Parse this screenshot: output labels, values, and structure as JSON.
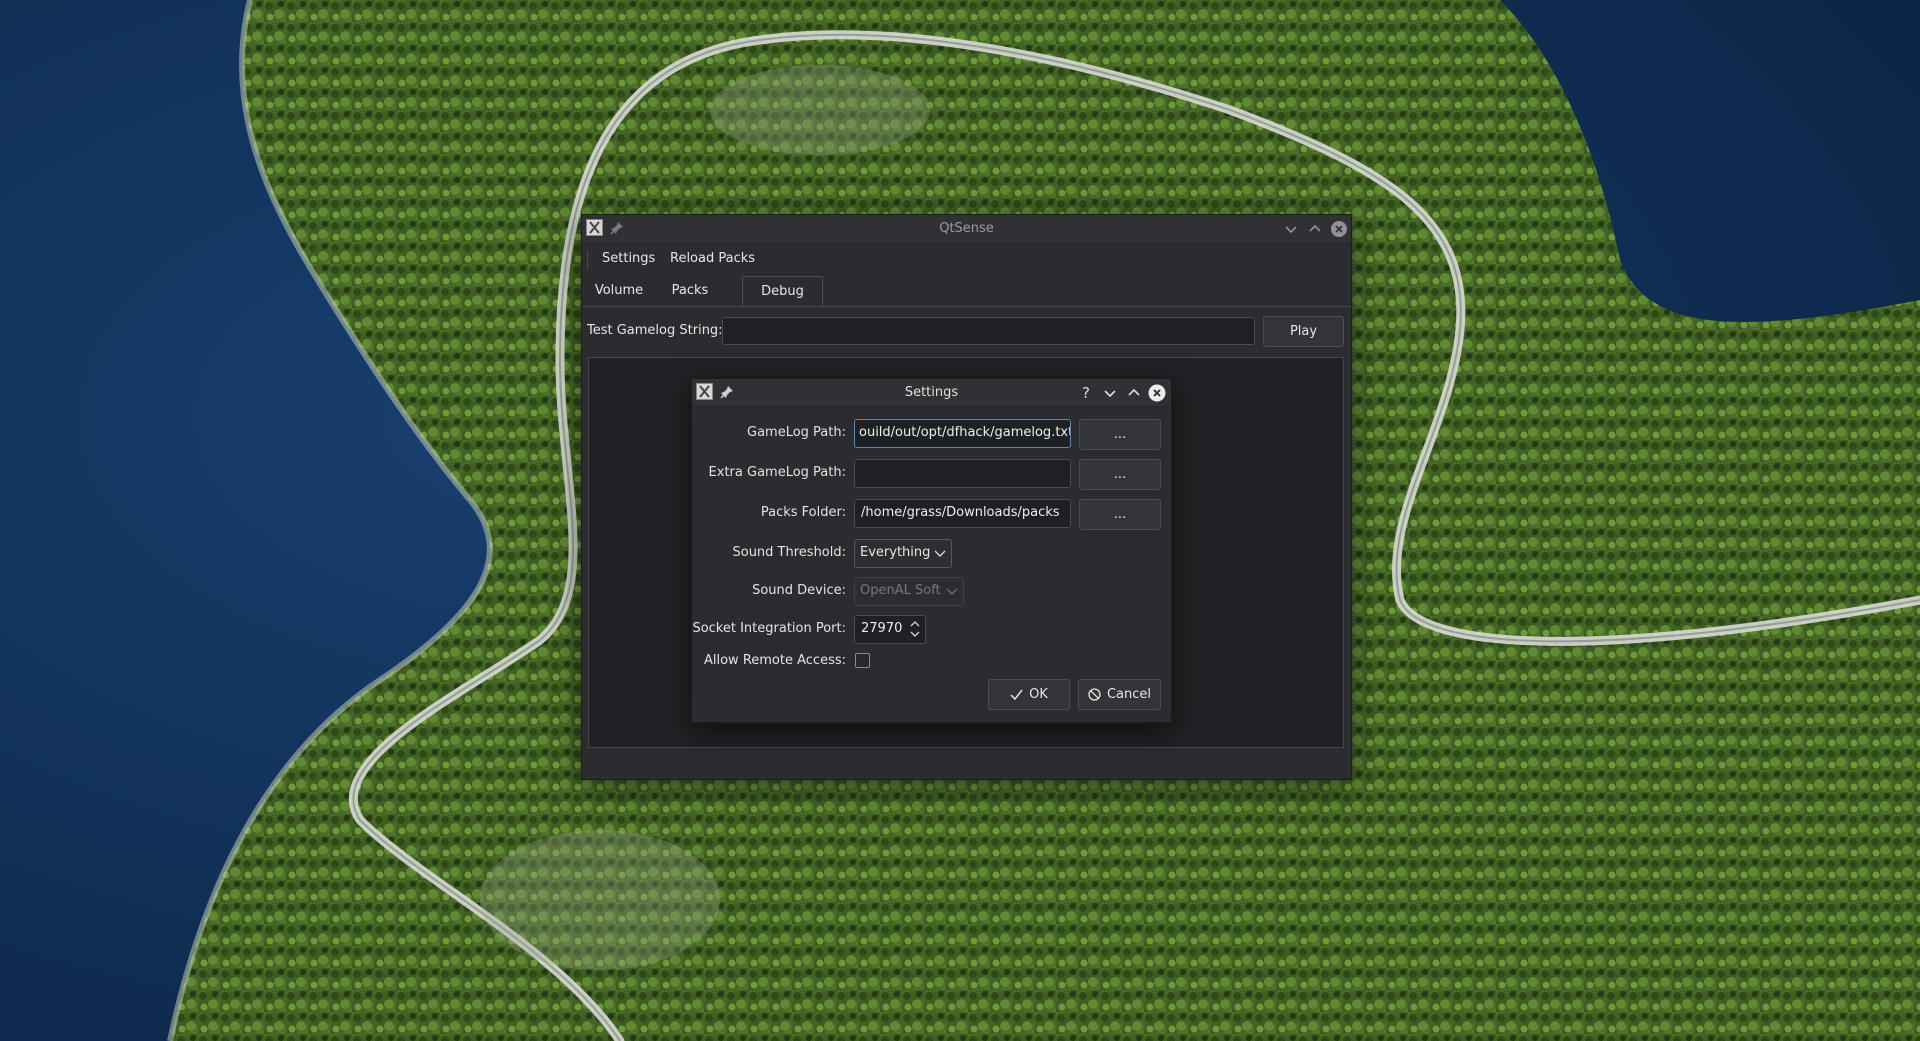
{
  "main_window": {
    "title": "QtSense",
    "menu": {
      "settings": "Settings",
      "reload_packs": "Reload Packs"
    },
    "tabs": [
      {
        "label": "Volume",
        "active": false
      },
      {
        "label": "Packs",
        "active": false
      },
      {
        "label": "Debug",
        "active": true
      }
    ],
    "debug": {
      "test_label": "Test Gamelog String:",
      "test_value": "",
      "play_label": "Play"
    }
  },
  "settings_dialog": {
    "title": "Settings",
    "help_glyph": "?",
    "gamelog_path": {
      "label": "GameLog Path:",
      "value": "build/out/opt/dfhack/gamelog.txt",
      "visible_value": "ouild/out/opt/dfhack/gamelog.txt"
    },
    "extra_gamelog_path": {
      "label": "Extra GameLog Path:",
      "value": ""
    },
    "packs_folder": {
      "label": "Packs Folder:",
      "value": "/home/grass/Downloads/packs"
    },
    "browse_label": "...",
    "sound_threshold": {
      "label": "Sound Threshold:",
      "value": "Everything"
    },
    "sound_device": {
      "label": "Sound Device:",
      "value": "OpenAL Soft",
      "disabled": true
    },
    "socket_port": {
      "label": "Socket Integration Port:",
      "value": "27970"
    },
    "allow_remote": {
      "label": "Allow Remote Access:",
      "checked": false
    },
    "ok_label": "OK",
    "cancel_label": "Cancel"
  },
  "colors": {
    "window_bg": "#2a2c2f",
    "titlebar_bg": "#2f3134",
    "input_bg": "#1f2023",
    "close_button": "#e8e8e8",
    "lake": "#0f2a4a",
    "forest": "#3c5a22"
  },
  "icons": {
    "app": "x-window-icon",
    "pin": "pin-icon",
    "minimize": "chevron-down-icon",
    "maximize": "chevron-up-icon",
    "close": "close-circle-icon",
    "ok": "checkmark-icon",
    "cancel": "cancel-circle-icon"
  }
}
